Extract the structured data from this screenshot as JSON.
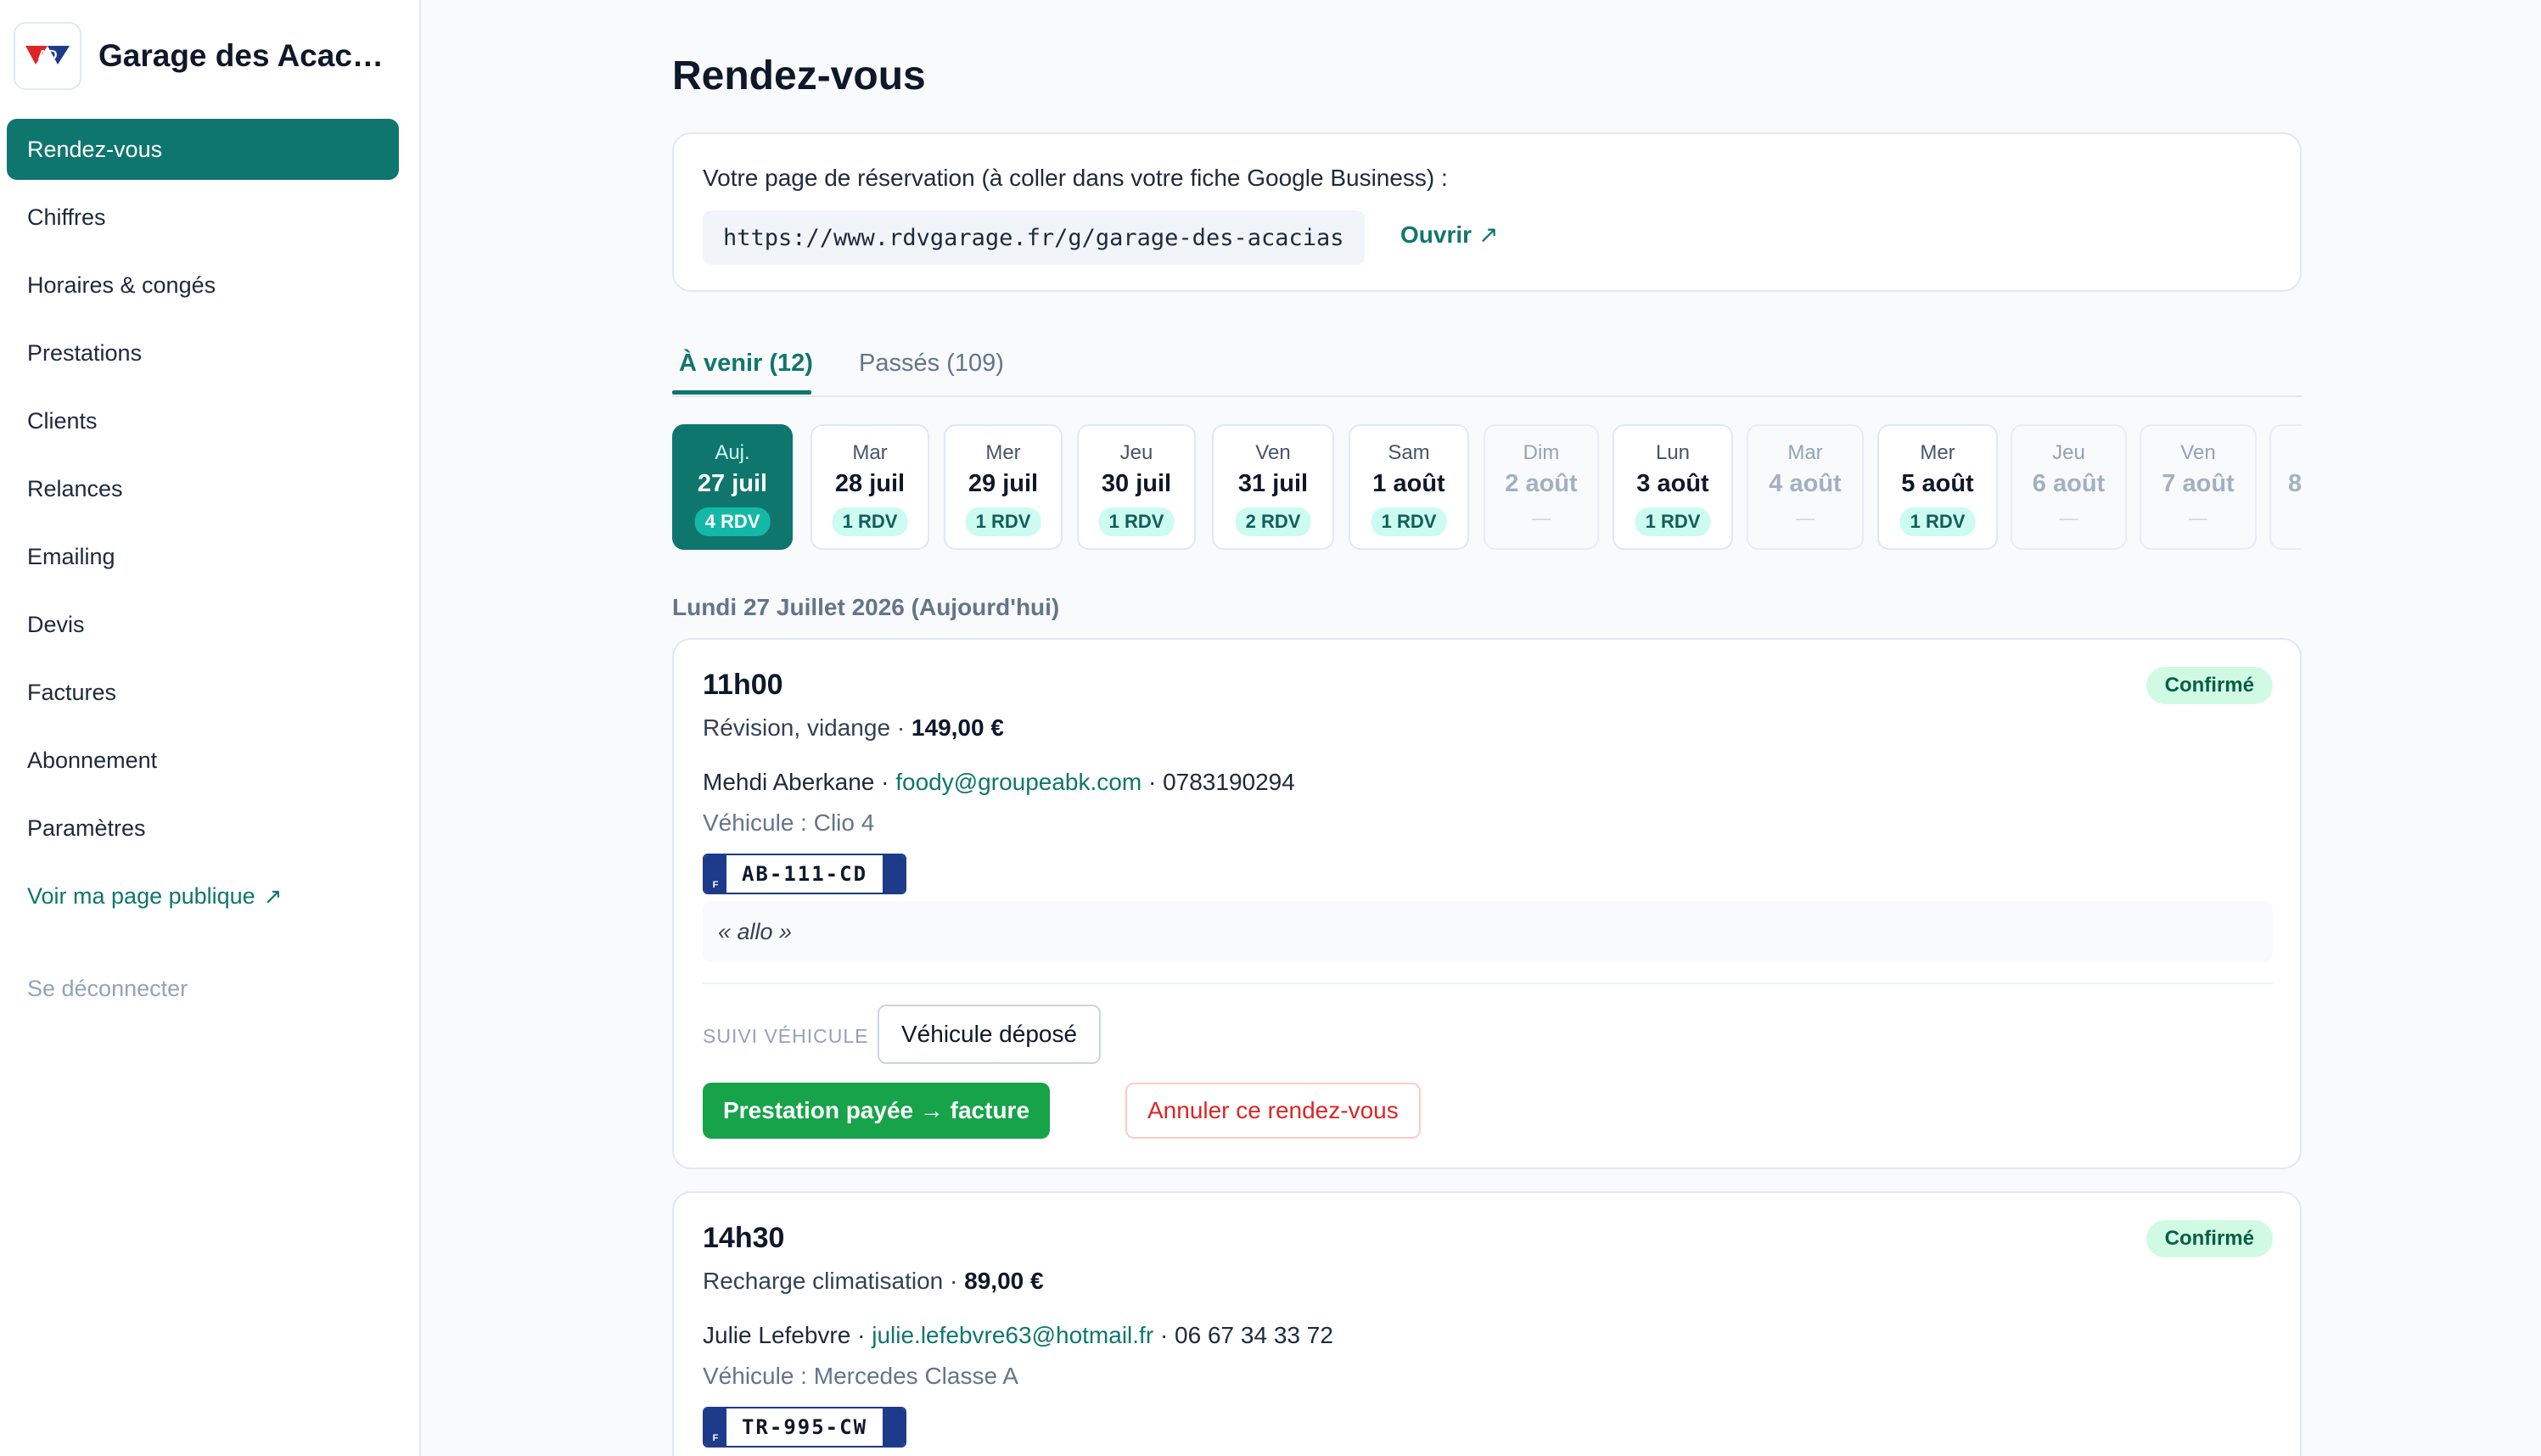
{
  "sidebar": {
    "garage_name": "Garage des Acacias",
    "logo_text": "AD",
    "items": [
      {
        "label": "Rendez-vous",
        "active": true
      },
      {
        "label": "Chiffres"
      },
      {
        "label": "Horaires & congés"
      },
      {
        "label": "Prestations"
      },
      {
        "label": "Clients"
      },
      {
        "label": "Relances"
      },
      {
        "label": "Emailing"
      },
      {
        "label": "Devis"
      },
      {
        "label": "Factures"
      },
      {
        "label": "Abonnement"
      },
      {
        "label": "Paramètres"
      }
    ],
    "public_page_label": "Voir ma page publique",
    "logout_label": "Se déconnecter"
  },
  "page": {
    "title": "Rendez-vous"
  },
  "booking": {
    "label": "Votre page de réservation (à coller dans votre fiche Google Business) :",
    "url": "https://www.rdvgarage.fr/g/garage-des-acacias",
    "open_label": "Ouvrir"
  },
  "tabs": [
    {
      "label": "À venir (12)",
      "active": true
    },
    {
      "label": "Passés (109)"
    }
  ],
  "days": [
    {
      "name": "Auj.",
      "date": "27 juil",
      "badge": "4 RDV",
      "state": "active"
    },
    {
      "name": "Mar",
      "date": "28 juil",
      "badge": "1 RDV",
      "state": "open"
    },
    {
      "name": "Mer",
      "date": "29 juil",
      "badge": "1 RDV",
      "state": "open"
    },
    {
      "name": "Jeu",
      "date": "30 juil",
      "badge": "1 RDV",
      "state": "open"
    },
    {
      "name": "Ven",
      "date": "31 juil",
      "badge": "2 RDV",
      "state": "open"
    },
    {
      "name": "Sam",
      "date": "1 août",
      "badge": "1 RDV",
      "state": "open"
    },
    {
      "name": "Dim",
      "date": "2 août",
      "badge": "—",
      "state": "closed"
    },
    {
      "name": "Lun",
      "date": "3 août",
      "badge": "1 RDV",
      "state": "open"
    },
    {
      "name": "Mar",
      "date": "4 août",
      "badge": "—",
      "state": "closed"
    },
    {
      "name": "Mer",
      "date": "5 août",
      "badge": "1 RDV",
      "state": "open"
    },
    {
      "name": "Jeu",
      "date": "6 août",
      "badge": "—",
      "state": "closed"
    },
    {
      "name": "Ven",
      "date": "7 août",
      "badge": "—",
      "state": "closed"
    },
    {
      "name": "",
      "date": "8",
      "badge": "",
      "state": "partial"
    }
  ],
  "date_heading": "Lundi 27 Juillet 2026 (Aujourd'hui)",
  "appointments": [
    {
      "time": "11h00",
      "status": "Confirmé",
      "service": "Révision, vidange",
      "price": "149,00 €",
      "client": "Mehdi Aberkane",
      "email": "foody@groupeabk.com",
      "phone": "0783190294",
      "vehicle": "Véhicule : Clio 4",
      "plate_country": "F",
      "plate": "AB-111-CD",
      "note": "« allo »",
      "suivi_label": "SUIVI VÉHICULE",
      "suivi_action": "Véhicule déposé",
      "pay_label": "Prestation payée → facture",
      "cancel_label": "Annuler ce rendez-vous"
    },
    {
      "time": "14h30",
      "status": "Confirmé",
      "service": "Recharge climatisation",
      "price": "89,00 €",
      "client": "Julie Lefebvre",
      "email": "julie.lefebvre63@hotmail.fr",
      "phone": "06 67 34 33 72",
      "vehicle": "Véhicule : Mercedes Classe A",
      "plate_country": "F",
      "plate": "TR-995-CW"
    }
  ],
  "colors": {
    "accent": "#0f766e",
    "pay_button": "#16a34a",
    "cancel": "#dc2626",
    "status_bg": "#d1fae5"
  }
}
